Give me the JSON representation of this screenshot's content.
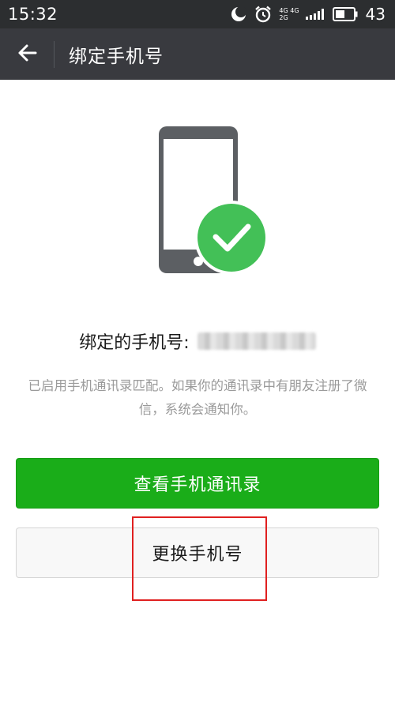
{
  "status_bar": {
    "time": "15:32",
    "network_top": "4G 4G",
    "network_bottom": "2G",
    "battery_level": "43",
    "icons": [
      "moon-icon",
      "alarm-icon",
      "signal-icon",
      "battery-icon"
    ]
  },
  "nav": {
    "back_icon": "arrow-left-icon",
    "title": "绑定手机号"
  },
  "illustration": {
    "icons": [
      "phone-icon",
      "check-circle-icon"
    ],
    "phone_color": "#5c5f63",
    "check_color": "#43c057"
  },
  "bound": {
    "label": "绑定的手机号:"
  },
  "description": "已启用手机通讯录匹配。如果你的通讯录中有朋友注册了微信，系统会通知你。",
  "buttons": {
    "view_contacts": "查看手机通讯录",
    "change_number": "更换手机号"
  },
  "colors": {
    "primary_green": "#1aad19",
    "nav_bg": "#393a3f",
    "status_bg": "#2c2e30",
    "highlight_red": "#e02020"
  }
}
